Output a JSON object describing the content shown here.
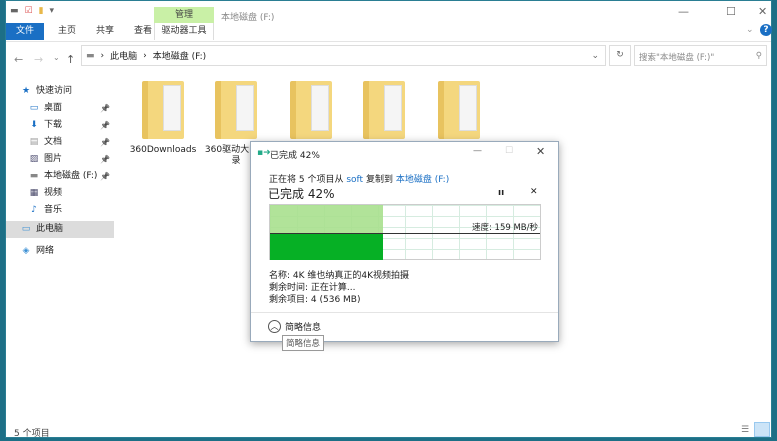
{
  "window": {
    "title": "本地磁盘 (F:)",
    "manage_tab": "管理",
    "minimize": "—",
    "maximize": "☐",
    "close": "✕"
  },
  "ribbon": {
    "tabs": [
      "文件",
      "主页",
      "共享",
      "查看",
      "驱动器工具"
    ]
  },
  "address": {
    "path": [
      "此电脑",
      "本地磁盘 (F:)"
    ],
    "search_placeholder": "搜索\"本地磁盘 (F:)\""
  },
  "sidebar": {
    "items": [
      {
        "label": "快速访问",
        "icon": "star-icon"
      },
      {
        "label": "桌面",
        "icon": "desktop-icon",
        "pinned": true
      },
      {
        "label": "下载",
        "icon": "download-icon",
        "pinned": true
      },
      {
        "label": "文档",
        "icon": "document-icon",
        "pinned": true
      },
      {
        "label": "图片",
        "icon": "picture-icon",
        "pinned": true
      },
      {
        "label": "本地磁盘 (F:)",
        "icon": "drive-icon",
        "pinned": true
      },
      {
        "label": "视频",
        "icon": "video-icon"
      },
      {
        "label": "音乐",
        "icon": "music-icon"
      },
      {
        "label": "此电脑",
        "icon": "computer-icon",
        "selected": true
      },
      {
        "label": "网络",
        "icon": "network-icon"
      }
    ]
  },
  "files": [
    {
      "name": "360Downloads"
    },
    {
      "name": "360驱动大师目录"
    },
    {
      "name": ""
    },
    {
      "name": ""
    },
    {
      "name": ""
    }
  ],
  "status": {
    "count": "5 个项目"
  },
  "dialog": {
    "title": "已完成 42%",
    "line_prefix": "正在将 5 个项目从",
    "source": "soft",
    "line_mid": "复制到",
    "dest": "本地磁盘 (F:)",
    "headline": "已完成 42%",
    "progress_percent": 42,
    "speed": "速度: 159 MB/秒",
    "name": "名称: 4K 维也纳真正的4K视频拍摄",
    "time_left": "剩余时间: 正在计算...",
    "items_left": "剩余项目: 4 (536 MB)",
    "less_details": "简略信息",
    "tooltip": "简略信息",
    "accent": "#06b025",
    "accent_light": "#a8e08e"
  }
}
